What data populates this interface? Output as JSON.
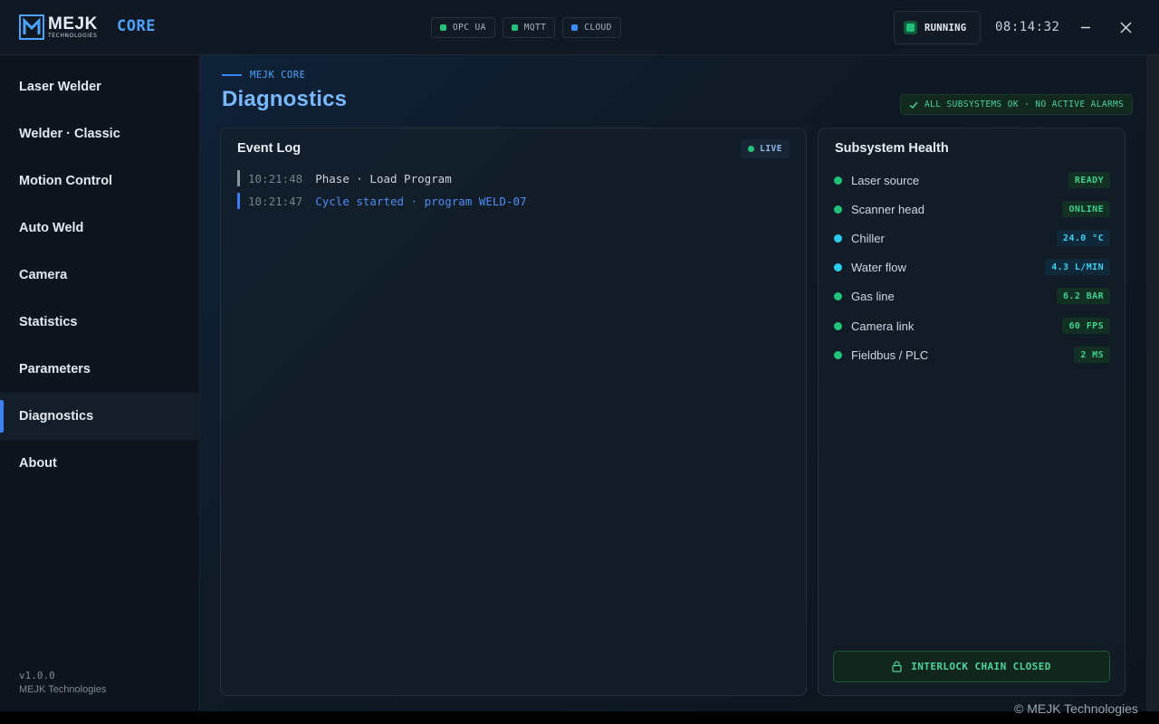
{
  "header": {
    "brand": "MEJK",
    "brand_sub": "TECHNOLOGIES",
    "product": "CORE",
    "protocols": [
      {
        "label": "OPC UA",
        "color": "#22c27a"
      },
      {
        "label": "MQTT",
        "color": "#22c27a"
      },
      {
        "label": "CLOUD",
        "color": "#3b8cf6"
      }
    ],
    "run_state": "RUNNING",
    "clock": "08:14:32",
    "window_controls": [
      "minimize-icon",
      "close-icon"
    ]
  },
  "sidebar": {
    "items": [
      {
        "label": "Laser Welder",
        "active": false
      },
      {
        "label": "Welder · Classic",
        "active": false
      },
      {
        "label": "Motion Control",
        "active": false
      },
      {
        "label": "Auto Weld",
        "active": false
      },
      {
        "label": "Camera",
        "active": false
      },
      {
        "label": "Statistics",
        "active": false
      },
      {
        "label": "Parameters",
        "active": false
      },
      {
        "label": "Diagnostics",
        "active": true
      },
      {
        "label": "About",
        "active": false
      }
    ],
    "version": "v1.0.0",
    "company": "MEJK Technologies"
  },
  "main": {
    "breadcrumb": "MEJK CORE",
    "title": "Diagnostics",
    "status": "ALL SUBSYSTEMS OK · NO ACTIVE ALARMS",
    "event_log": {
      "title": "Event Log",
      "live_label": "LIVE",
      "entries": [
        {
          "time": "10:21:48",
          "message": "Phase · Load Program",
          "color": "#c9d2dc",
          "bar": "#8a95a2"
        },
        {
          "time": "10:21:47",
          "message": "Cycle started · program WELD-07",
          "color": "#4d8cf0",
          "bar": "#3b7ff0"
        }
      ]
    },
    "health": {
      "title": "Subsystem Health",
      "items": [
        {
          "name": "Laser source",
          "value": "READY",
          "tone": "green"
        },
        {
          "name": "Scanner head",
          "value": "ONLINE",
          "tone": "green"
        },
        {
          "name": "Chiller",
          "value": "24.0 °C",
          "tone": "cyan"
        },
        {
          "name": "Water flow",
          "value": "4.3 L/MIN",
          "tone": "cyan"
        },
        {
          "name": "Gas line",
          "value": "6.2 BAR",
          "tone": "green"
        },
        {
          "name": "Camera link",
          "value": "60 FPS",
          "tone": "green"
        },
        {
          "name": "Fieldbus / PLC",
          "value": "2 MS",
          "tone": "green"
        }
      ],
      "interlock": "INTERLOCK CHAIN CLOSED"
    }
  },
  "footer": {
    "copyright": "© MEJK Technologies"
  },
  "colors": {
    "accent": "#3b82f6",
    "ok_green": "#3fd08e",
    "info_cyan": "#3fd0f0"
  }
}
